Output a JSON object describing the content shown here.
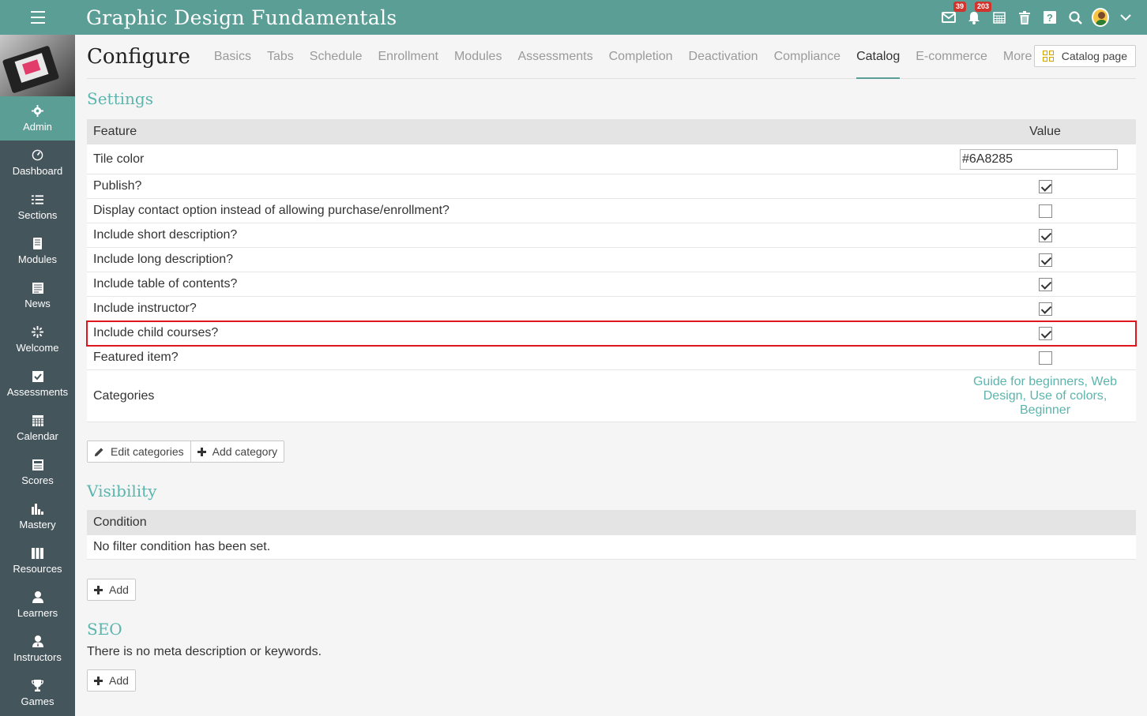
{
  "header": {
    "course_title": "Graphic Design Fundamentals",
    "badges": {
      "messages": "39",
      "notifications": "203"
    }
  },
  "sidebar": {
    "items": [
      {
        "label": "Admin",
        "icon": "gear-icon",
        "active": true
      },
      {
        "label": "Dashboard",
        "icon": "dashboard-icon"
      },
      {
        "label": "Sections",
        "icon": "list-icon"
      },
      {
        "label": "Modules",
        "icon": "book-icon"
      },
      {
        "label": "News",
        "icon": "newspaper-icon"
      },
      {
        "label": "Welcome",
        "icon": "sparkle-icon"
      },
      {
        "label": "Assessments",
        "icon": "checkbox-icon"
      },
      {
        "label": "Calendar",
        "icon": "calendar-icon"
      },
      {
        "label": "Scores",
        "icon": "scores-icon"
      },
      {
        "label": "Mastery",
        "icon": "bar-chart-icon"
      },
      {
        "label": "Resources",
        "icon": "library-icon"
      },
      {
        "label": "Learners",
        "icon": "person-icon"
      },
      {
        "label": "Instructors",
        "icon": "instructor-icon"
      },
      {
        "label": "Games",
        "icon": "trophy-icon"
      }
    ]
  },
  "config": {
    "title": "Configure",
    "tabs": [
      "Basics",
      "Tabs",
      "Schedule",
      "Enrollment",
      "Modules",
      "Assessments",
      "Completion",
      "Deactivation",
      "Compliance",
      "Catalog",
      "E-commerce",
      "More"
    ],
    "active_tab": "Catalog",
    "catalog_page_button": "Catalog page"
  },
  "settings": {
    "title": "Settings",
    "header_feature": "Feature",
    "header_value": "Value",
    "tile_color_label": "Tile color",
    "tile_color_value": "#6A8285",
    "rows": [
      {
        "label": "Publish?",
        "checked": true
      },
      {
        "label": "Display contact option instead of allowing purchase/enrollment?",
        "checked": false
      },
      {
        "label": "Include short description?",
        "checked": true
      },
      {
        "label": "Include long description?",
        "checked": true
      },
      {
        "label": "Include table of contents?",
        "checked": true
      },
      {
        "label": "Include instructor?",
        "checked": true
      },
      {
        "label": "Include child courses?",
        "checked": true,
        "highlighted": true
      },
      {
        "label": "Featured item?",
        "checked": false
      }
    ],
    "categories_label": "Categories",
    "categories": [
      "Guide for beginners",
      "Web Design",
      "Use of colors",
      "Beginner"
    ],
    "edit_categories_button": "Edit categories",
    "add_category_button": "Add category"
  },
  "visibility": {
    "title": "Visibility",
    "header_condition": "Condition",
    "empty_text": "No filter condition has been set.",
    "add_button": "Add"
  },
  "seo": {
    "title": "SEO",
    "empty_text": "There is no meta description or keywords.",
    "add_button": "Add"
  },
  "colors": {
    "topbar": "#5a9e96",
    "sidebar": "#45555c",
    "accent": "#5bb5ad",
    "highlight": "#e0161d"
  }
}
